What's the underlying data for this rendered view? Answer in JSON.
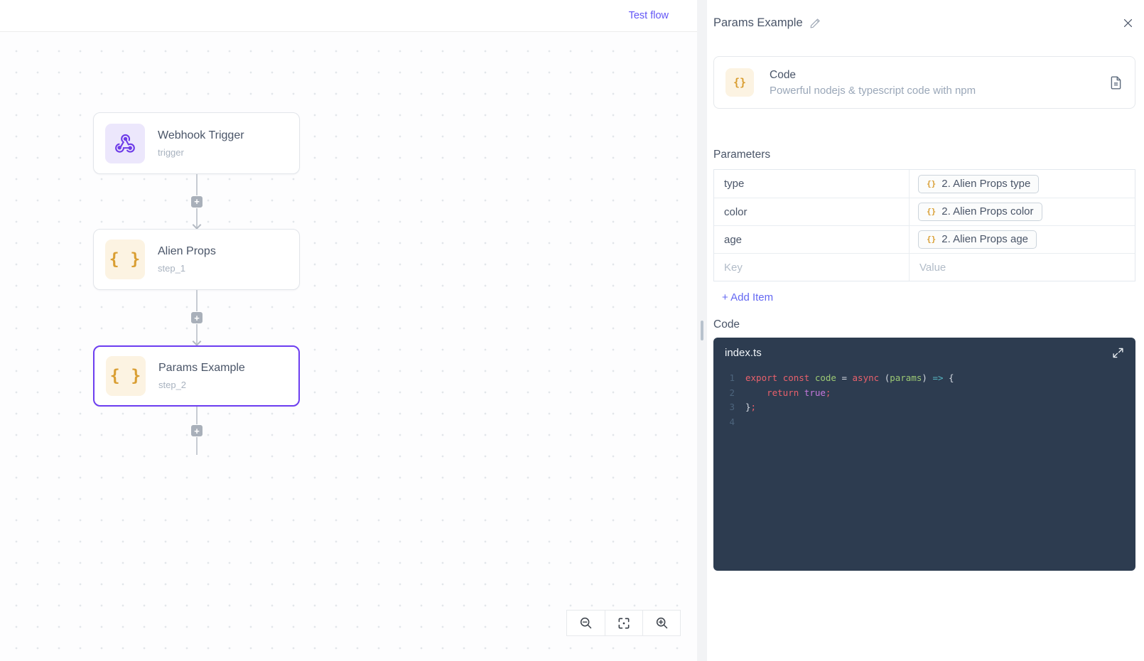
{
  "topbar": {
    "test_flow_label": "Test flow"
  },
  "icons": {
    "braces": "{ }",
    "braces_small": "{}",
    "plus": "+"
  },
  "colors": {
    "accent_link": "#6356f6",
    "selected_node_border": "#6d3ef0",
    "webhook_purple": "#6d3be8",
    "braces_orange": "#d99e32",
    "editor_bg": "#2d3c50",
    "keyword_red": "#e9616c",
    "ident_green": "#9cc974",
    "arrow_cyan": "#56b6c2",
    "bool_purple": "#c678dd"
  },
  "canvas": {
    "nodes": [
      {
        "title": "Webhook Trigger",
        "subtitle": "trigger",
        "icon": "webhook-icon"
      },
      {
        "title": "Alien Props",
        "subtitle": "step_1",
        "icon": "braces-icon"
      },
      {
        "title": "Params Example",
        "subtitle": "step_2",
        "icon": "braces-icon",
        "selected": true
      }
    ],
    "zoom_controls": [
      "zoom-out",
      "fit-view",
      "zoom-in"
    ]
  },
  "panel": {
    "title": "Params Example",
    "card": {
      "title": "Code",
      "subtitle": "Powerful nodejs & typescript code with npm"
    },
    "parameters": {
      "heading": "Parameters",
      "rows": [
        {
          "key": "type",
          "token": "2. Alien Props type"
        },
        {
          "key": "color",
          "token": "2. Alien Props color"
        },
        {
          "key": "age",
          "token": "2. Alien Props age"
        }
      ],
      "key_placeholder": "Key",
      "value_placeholder": "Value",
      "add_item_label": "+ Add Item"
    },
    "code": {
      "heading": "Code",
      "filename": "index.ts",
      "lines": [
        {
          "n": "1",
          "tokens": [
            [
              "export ",
              "red"
            ],
            [
              "const ",
              "red"
            ],
            [
              "code",
              "green"
            ],
            [
              " = ",
              "white"
            ],
            [
              "async ",
              "red"
            ],
            [
              "(",
              "white"
            ],
            [
              "params",
              "green"
            ],
            [
              ") ",
              "white"
            ],
            [
              "=>",
              "cyan"
            ],
            [
              " {",
              "white"
            ]
          ]
        },
        {
          "n": "2",
          "tokens": [
            [
              "    ",
              "white"
            ],
            [
              "return ",
              "red"
            ],
            [
              "true",
              "purple"
            ],
            [
              ";",
              "red"
            ]
          ]
        },
        {
          "n": "3",
          "tokens": [
            [
              "}",
              "white"
            ],
            [
              ";",
              "red"
            ]
          ]
        },
        {
          "n": "4",
          "tokens": []
        }
      ]
    }
  }
}
